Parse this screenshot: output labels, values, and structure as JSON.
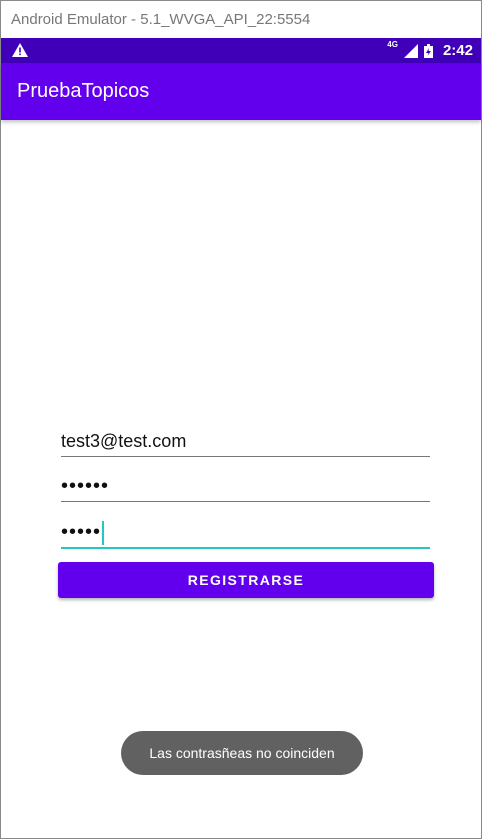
{
  "emulator": {
    "title": "Android Emulator - 5.1_WVGA_API_22:5554"
  },
  "statusbar": {
    "network": "4G",
    "time": "2:42",
    "icons": [
      "warning-icon",
      "signal-icon",
      "battery-icon"
    ]
  },
  "appbar": {
    "title": "PruebaTopicos",
    "color": "#6200ee"
  },
  "form": {
    "email_value": "test3@test.com",
    "password_value": "••••••",
    "confirm_password_value": "•••••"
  },
  "button": {
    "label": "REGISTRARSE"
  },
  "toast": {
    "message": "Las contrasñeas no coinciden"
  },
  "colors": {
    "statusbar": "#3f00b8",
    "accent": "#26c6c2",
    "toast": "#616161"
  }
}
